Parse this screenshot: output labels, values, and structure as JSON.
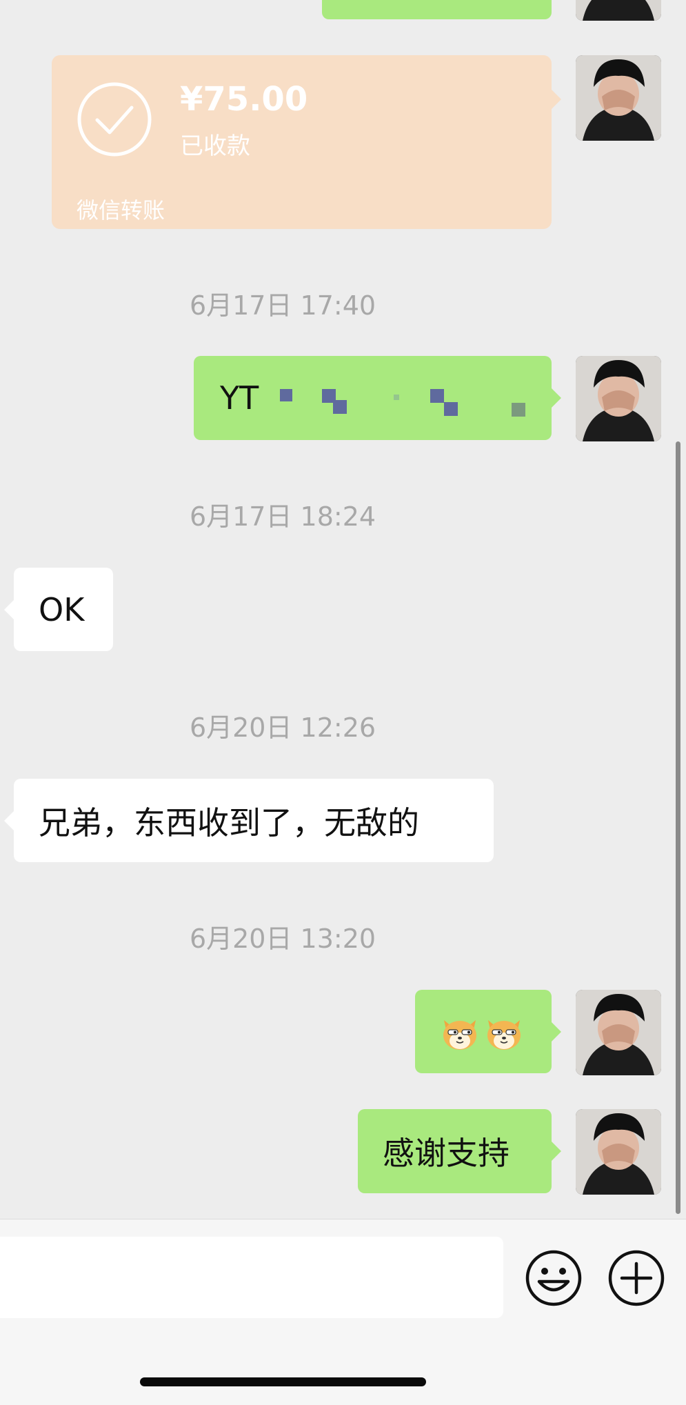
{
  "transfer": {
    "amount": "¥75.00",
    "status": "已收款",
    "footer": "微信转账"
  },
  "messages": [
    {
      "side": "right",
      "type": "text",
      "text": "YT"
    },
    {
      "side": "left",
      "type": "text",
      "text": "OK"
    },
    {
      "side": "left",
      "type": "text",
      "text": "兄弟，东西收到了，无敌的"
    },
    {
      "side": "right",
      "type": "emoji",
      "emoji": [
        "shiba-dog-emoji",
        "shiba-dog-emoji"
      ]
    },
    {
      "side": "right",
      "type": "text",
      "text": "感谢支持"
    }
  ],
  "timestamps": [
    "6月17日 17:40",
    "6月17日 18:24",
    "6月20日 12:26",
    "6月20日 13:20"
  ],
  "colors": {
    "background": "#ededed",
    "outgoing_bubble": "#a9e97e",
    "incoming_bubble": "#ffffff",
    "transfer_card": "#f8dec6",
    "timestamp_text": "#a8a8a8"
  },
  "input_bar": {
    "icons": [
      "emoji-face-icon",
      "plus-circle-icon"
    ]
  }
}
